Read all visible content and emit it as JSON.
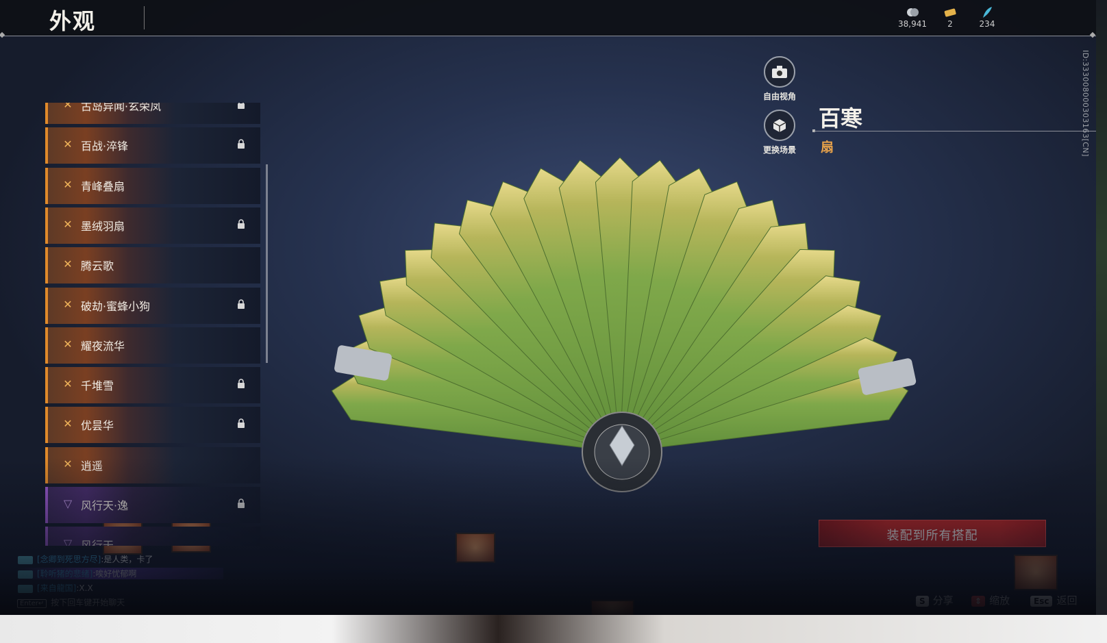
{
  "header": {
    "title": "外观",
    "currencies": [
      {
        "icon": "coin-icon",
        "value": "38,941"
      },
      {
        "icon": "ticket-icon",
        "value": "2"
      },
      {
        "icon": "feather-icon",
        "value": "234"
      }
    ]
  },
  "list": {
    "items": [
      {
        "label": "古岛异闻·玄荣凤",
        "locked": true,
        "rarity": "orange"
      },
      {
        "label": "百战·淬锋",
        "locked": true,
        "rarity": "orange"
      },
      {
        "label": "青峰叠扇",
        "locked": false,
        "rarity": "orange"
      },
      {
        "label": "墨绒羽扇",
        "locked": true,
        "rarity": "orange"
      },
      {
        "label": "腾云歌",
        "locked": false,
        "rarity": "orange"
      },
      {
        "label": "破劫·蜜蜂小狗",
        "locked": true,
        "rarity": "orange"
      },
      {
        "label": "耀夜流华",
        "locked": false,
        "rarity": "orange"
      },
      {
        "label": "千堆雪",
        "locked": true,
        "rarity": "orange"
      },
      {
        "label": "优昙华",
        "locked": true,
        "rarity": "orange"
      },
      {
        "label": "逍遥",
        "locked": false,
        "rarity": "orange"
      },
      {
        "label": "风行天·逸",
        "locked": true,
        "rarity": "purple"
      },
      {
        "label": "风行天",
        "locked": false,
        "rarity": "purple"
      }
    ]
  },
  "side_buttons": {
    "free_view": "自由视角",
    "change_scene": "更换场景"
  },
  "item": {
    "name": "百寒",
    "type": "扇",
    "id": "ID:333008000303163[CN]"
  },
  "equip_button": "装配到所有搭配",
  "chat": {
    "messages": [
      {
        "who": "[念卿到死思方尽]",
        "text": ":是人类，卡了"
      },
      {
        "who": "[聆听猪的悲绪]",
        "text": ":唉好忧郁啊"
      },
      {
        "who": "[来自龍国]",
        "text": ":X.X"
      }
    ],
    "hint_key": "Enter↵",
    "hint": "按下回车键开始聊天"
  },
  "hotkeys": [
    {
      "key": "S",
      "label": "分享"
    },
    {
      "key": "⇕",
      "label": "缩放"
    },
    {
      "key": "Esc",
      "label": "返回"
    }
  ],
  "colors": {
    "accent_orange": "#e08a2a",
    "accent_purple": "#9b5ad0",
    "equip_red": "#c62a2a",
    "type_gold": "#e8a24a"
  }
}
